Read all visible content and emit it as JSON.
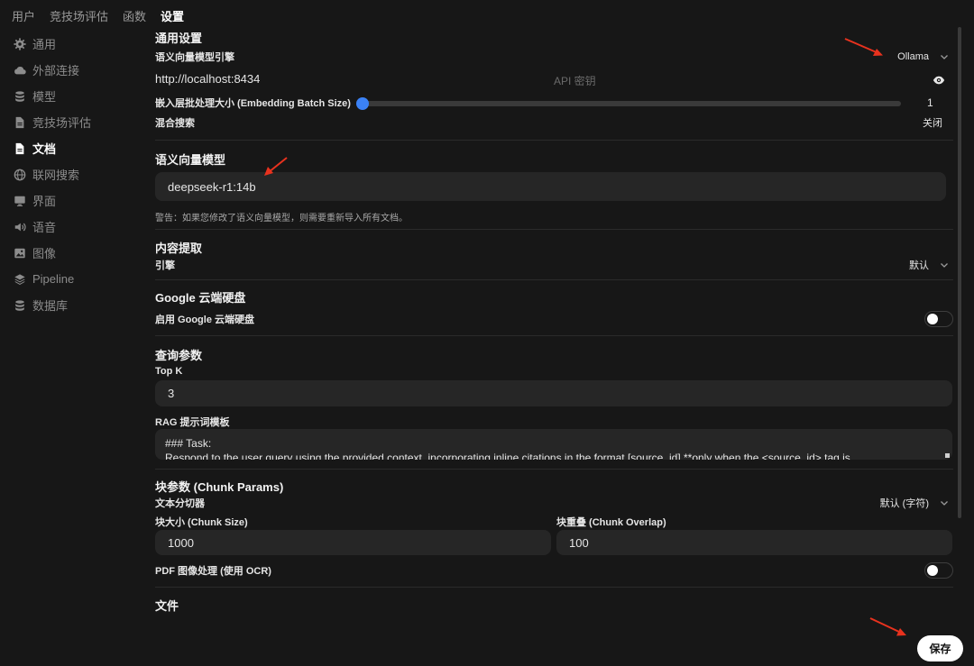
{
  "top_tabs": [
    "用户",
    "竞技场评估",
    "函数",
    "设置"
  ],
  "sidebar": {
    "items": [
      {
        "label": "通用",
        "icon": "gear-icon"
      },
      {
        "label": "外部连接",
        "icon": "cloud-icon"
      },
      {
        "label": "模型",
        "icon": "database-icon"
      },
      {
        "label": "竞技场评估",
        "icon": "document-icon"
      },
      {
        "label": "文档",
        "icon": "document-filled-icon"
      },
      {
        "label": "联网搜索",
        "icon": "globe-icon"
      },
      {
        "label": "界面",
        "icon": "monitor-icon"
      },
      {
        "label": "语音",
        "icon": "speaker-icon"
      },
      {
        "label": "图像",
        "icon": "image-icon"
      },
      {
        "label": "Pipeline",
        "icon": "layers-icon"
      },
      {
        "label": "数据库",
        "icon": "database-icon"
      }
    ],
    "active_index": 4
  },
  "general": {
    "title": "通用设置",
    "engine_label": "语义向量模型引擎",
    "engine_value": "Ollama",
    "url_value": "http://localhost:8434",
    "api_key_placeholder": "API 密钥",
    "batch_label": "嵌入层批处理大小 (Embedding Batch Size)",
    "batch_value": "1",
    "batch_fraction": 0,
    "hybrid_label": "混合搜索",
    "hybrid_value": "关闭"
  },
  "embedding": {
    "title": "语义向量模型",
    "model_value": "deepseek-r1:14b",
    "warning": "警告：如果您修改了语义向量模型，则需要重新导入所有文档。"
  },
  "extraction": {
    "title": "内容提取",
    "engine_label": "引擎",
    "engine_value": "默认"
  },
  "gdrive": {
    "title": "Google 云端硬盘",
    "enable_label": "启用 Google 云端硬盘",
    "enabled": false
  },
  "query": {
    "title": "查询参数",
    "topk_label": "Top K",
    "topk_value": "3",
    "rag_label": "RAG 提示词模板",
    "rag_line1": "### Task:",
    "rag_line2": "Respond to the user query using the provided context, incorporating inline citations in the format [source_id] **only when the <source_id> tag is"
  },
  "chunk": {
    "title": "块参数 (Chunk Params)",
    "splitter_label": "文本分切器",
    "splitter_value": "默认 (字符)",
    "size_label": "块大小 (Chunk Size)",
    "size_value": "1000",
    "overlap_label": "块重叠 (Chunk Overlap)",
    "overlap_value": "100",
    "pdf_label": "PDF 图像处理 (使用 OCR)",
    "pdf_enabled": false
  },
  "files": {
    "title": "文件"
  },
  "save_label": "保存",
  "colors": {
    "background": "#171717",
    "input": "#262626",
    "slider_accent": "#3b82f6",
    "annotation_arrow": "#e8321e"
  }
}
